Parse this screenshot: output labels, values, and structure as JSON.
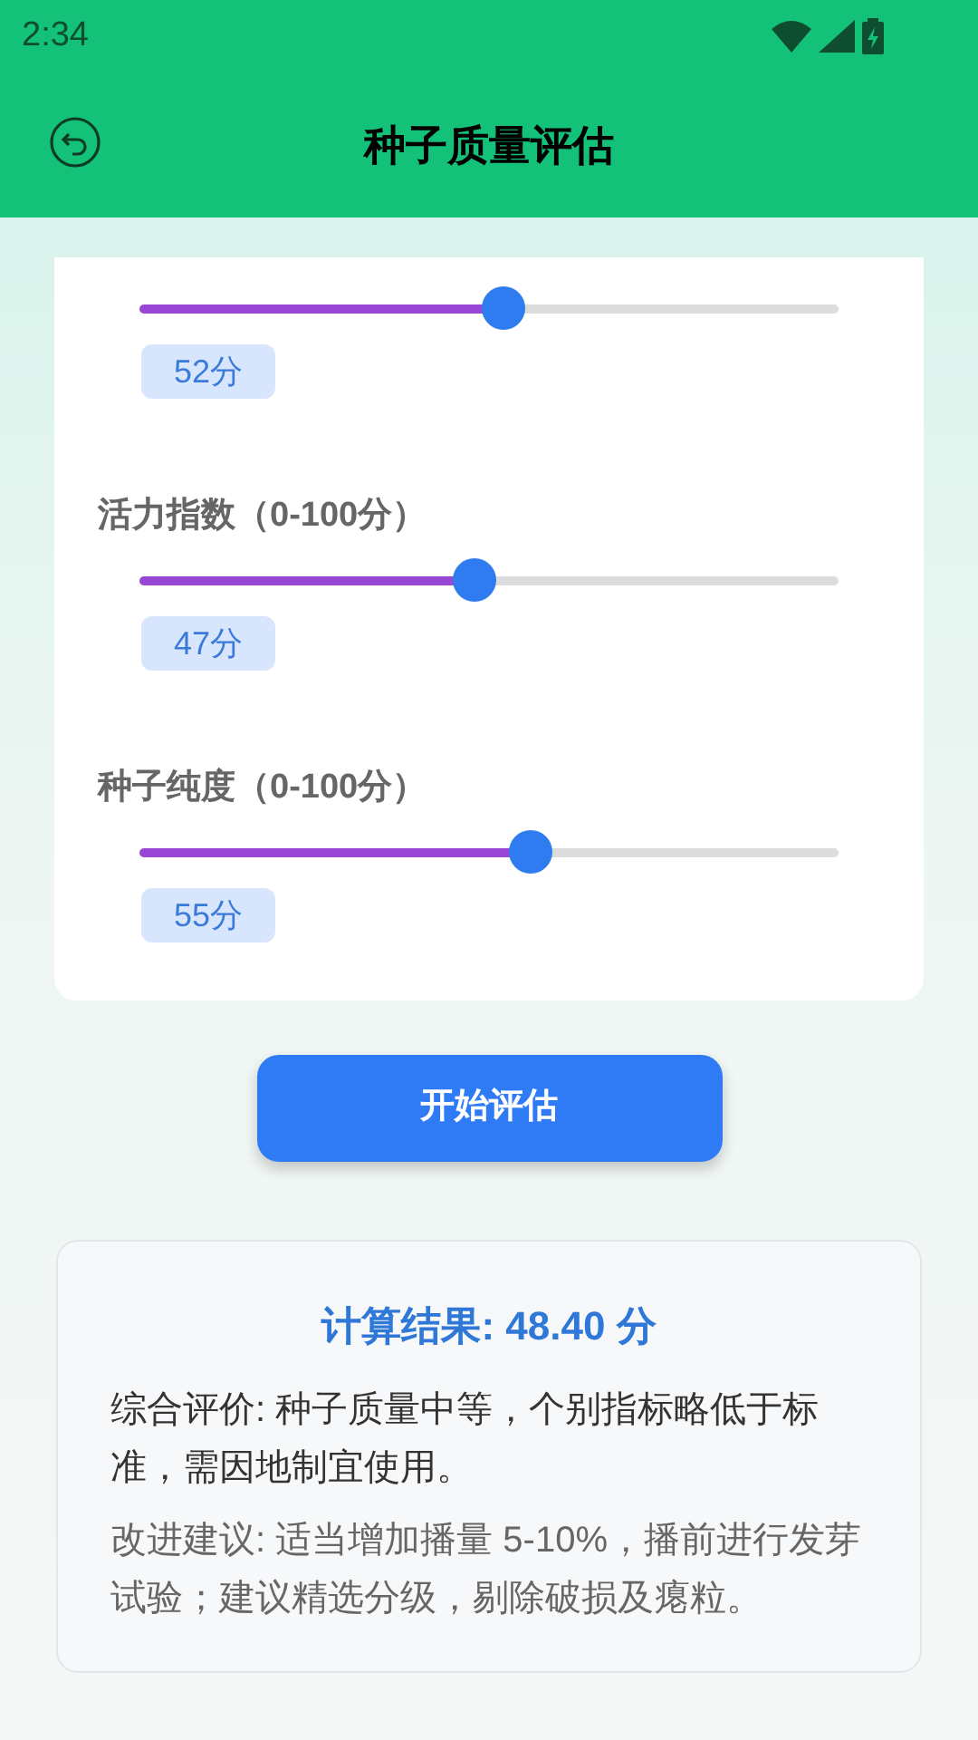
{
  "status_bar": {
    "time": "2:34"
  },
  "header": {
    "title": "种子质量评估"
  },
  "sliders": [
    {
      "level": 0.52,
      "value": "52分"
    },
    {
      "label": "活力指数（0-100分）",
      "level": 0.48,
      "value": "47分"
    },
    {
      "label": "种子纯度（0-100分）",
      "level": 0.56,
      "value": "55分"
    }
  ],
  "action_button": "开始评估",
  "result": {
    "title": "计算结果: 48.40 分",
    "evaluation": "综合评价: 种子质量中等，个别指标略低于标准，需因地制宜使用。",
    "suggestion": "改进建议: 适当增加播量 5-10%，播前进行发芽试验；建议精选分级，剔除破损及瘪粒。"
  }
}
